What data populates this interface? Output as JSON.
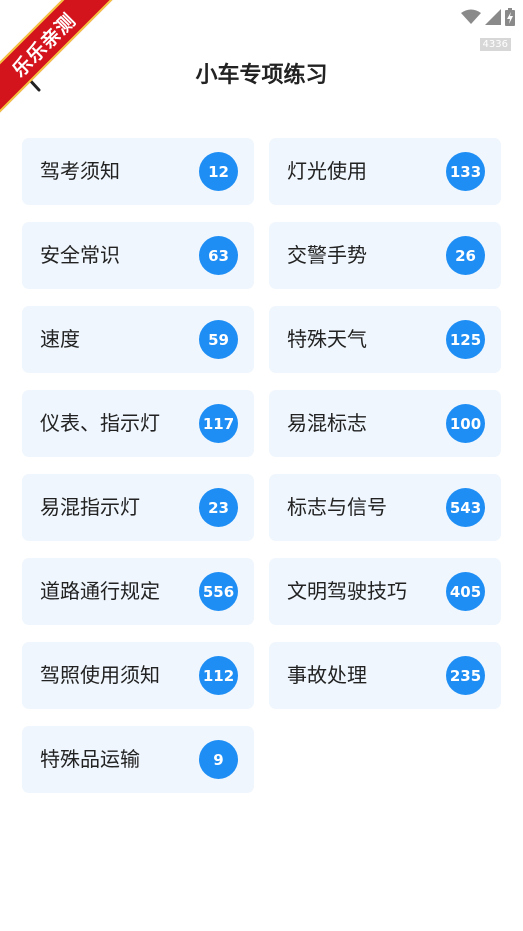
{
  "watermark": "乐乐亲测",
  "status_bar": {
    "badge_number": "4336"
  },
  "header": {
    "title": "小车专项练习"
  },
  "colors": {
    "accent": "#1e8ef5",
    "card_bg": "#eff6fd",
    "ribbon": "#d4141c"
  },
  "categories": [
    {
      "label": "驾考须知",
      "count": "12"
    },
    {
      "label": "灯光使用",
      "count": "133"
    },
    {
      "label": "安全常识",
      "count": "63"
    },
    {
      "label": "交警手势",
      "count": "26"
    },
    {
      "label": "速度",
      "count": "59"
    },
    {
      "label": "特殊天气",
      "count": "125"
    },
    {
      "label": "仪表、指示灯",
      "count": "117"
    },
    {
      "label": "易混标志",
      "count": "100"
    },
    {
      "label": "易混指示灯",
      "count": "23"
    },
    {
      "label": "标志与信号",
      "count": "543"
    },
    {
      "label": "道路通行规定",
      "count": "556"
    },
    {
      "label": "文明驾驶技巧",
      "count": "405"
    },
    {
      "label": "驾照使用须知",
      "count": "112"
    },
    {
      "label": "事故处理",
      "count": "235"
    },
    {
      "label": "特殊品运输",
      "count": "9"
    }
  ]
}
